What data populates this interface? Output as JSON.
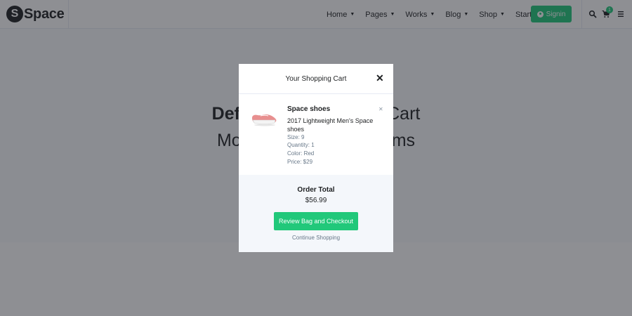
{
  "brand": {
    "logo_letter": "S",
    "name": "Space"
  },
  "nav": {
    "items": [
      {
        "label": "Home",
        "has_dropdown": true
      },
      {
        "label": "Pages",
        "has_dropdown": true
      },
      {
        "label": "Works",
        "has_dropdown": true
      },
      {
        "label": "Blog",
        "has_dropdown": true
      },
      {
        "label": "Shop",
        "has_dropdown": true
      },
      {
        "label": "Starter",
        "has_dropdown": false
      }
    ],
    "signin_label": "Signin",
    "cart_count": "1",
    "icons": [
      "search-icon",
      "cart-icon",
      "menu-icon"
    ]
  },
  "hero": {
    "line1_bold": "Defau",
    "line1_rest": "Cart",
    "line2_left": "Mo",
    "line2_right": "ms"
  },
  "modal": {
    "title": "Your Shopping Cart",
    "close_icon": "close-icon",
    "item": {
      "name": "Space shoes",
      "description": "2017 Lightweight Men's Space shoes",
      "size": "Size: 9",
      "quantity": "Quantity: 1",
      "color": "Color: Red",
      "price": "Price: $29",
      "image_icon": "shoe-image",
      "remove_icon": "remove-icon"
    },
    "order_total_label": "Order Total",
    "order_total_value": "$56.99",
    "checkout_label": "Review Bag and Checkout",
    "continue_label": "Continue Shopping"
  },
  "colors": {
    "accent": "#21c87a",
    "overlay": "rgba(30,32,40,0.5)",
    "footer_bg": "#f4f7fb"
  }
}
